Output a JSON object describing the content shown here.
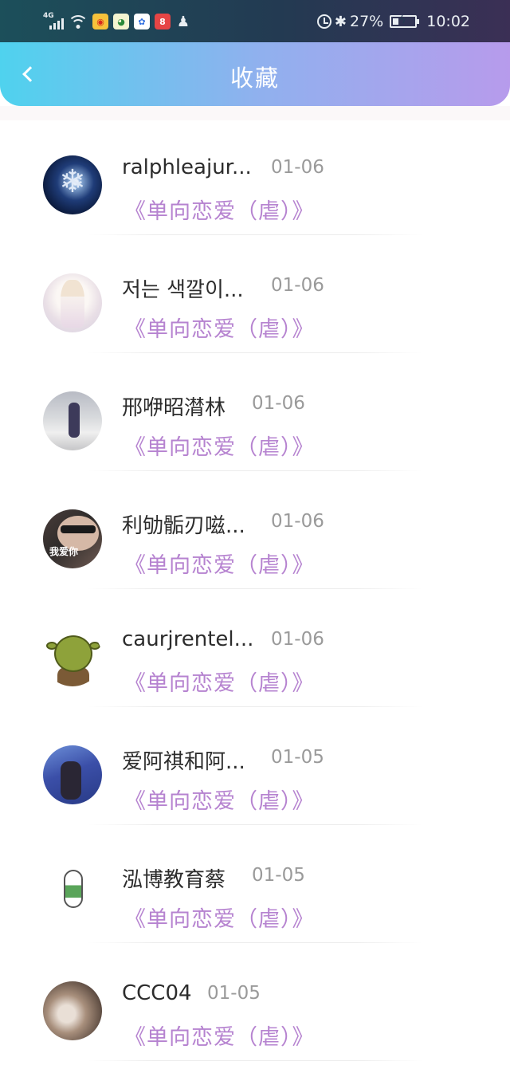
{
  "status_bar": {
    "network": "4G",
    "battery": "27%",
    "time": "10:02",
    "battery_level": 0.27
  },
  "header": {
    "title": "收藏",
    "back_icon": "chevron-left-icon"
  },
  "colors": {
    "header_gradient_start": "#4fd2ee",
    "header_gradient_end": "#b79bec",
    "book_title_color": "#b683d0",
    "date_color": "#9a9a9a"
  },
  "items": [
    {
      "name": "ralphleajur...",
      "date": "01-06",
      "book": "《单向恋爱（虐）》"
    },
    {
      "name": "저는 색깔이...",
      "date": "01-06",
      "book": "《单向恋爱（虐）》"
    },
    {
      "name": "邢咿昭潸林",
      "date": "01-06",
      "book": "《单向恋爱（虐）》"
    },
    {
      "name": "利劬骺刃嗞...",
      "date": "01-06",
      "book": "《单向恋爱（虐）》"
    },
    {
      "name": "caurjrentel...",
      "date": "01-06",
      "book": "《单向恋爱（虐）》"
    },
    {
      "name": "爱阿祺和阿...",
      "date": "01-05",
      "book": "《单向恋爱（虐）》"
    },
    {
      "name": "泓博教育蔡",
      "date": "01-05",
      "book": "《单向恋爱（虐）》"
    },
    {
      "name": "CCC04",
      "date": "01-05",
      "book": "《单向恋爱（虐）》"
    }
  ],
  "avatar_text_4": "我爱你"
}
